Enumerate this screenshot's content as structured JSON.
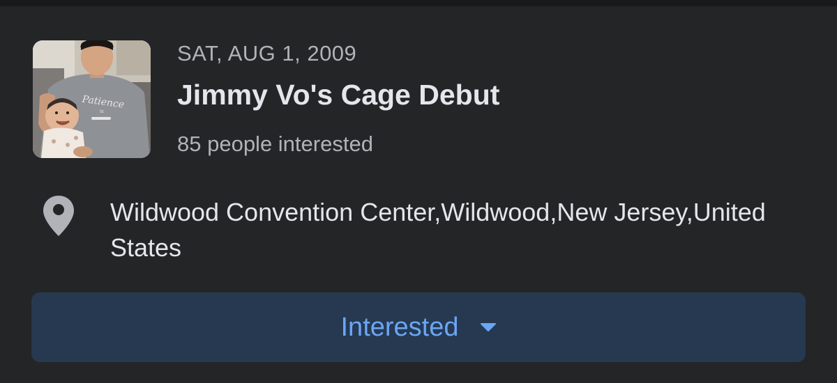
{
  "event": {
    "date": "SAT, AUG 1, 2009",
    "title": "Jimmy Vo's Cage Debut",
    "interested_count": "85 people interested",
    "thumbnail_shirt_text": "Patience is"
  },
  "location": {
    "icon": "location-pin-icon",
    "text": "Wildwood Convention Center,Wildwood,New Jersey,United States"
  },
  "action": {
    "label": "Interested",
    "icon": "caret-down-icon"
  },
  "colors": {
    "background": "#242526",
    "button_bg": "#263951",
    "button_text": "#6aa6f5",
    "primary_text": "#e4e6eb",
    "secondary_text": "#b0b3b8"
  }
}
